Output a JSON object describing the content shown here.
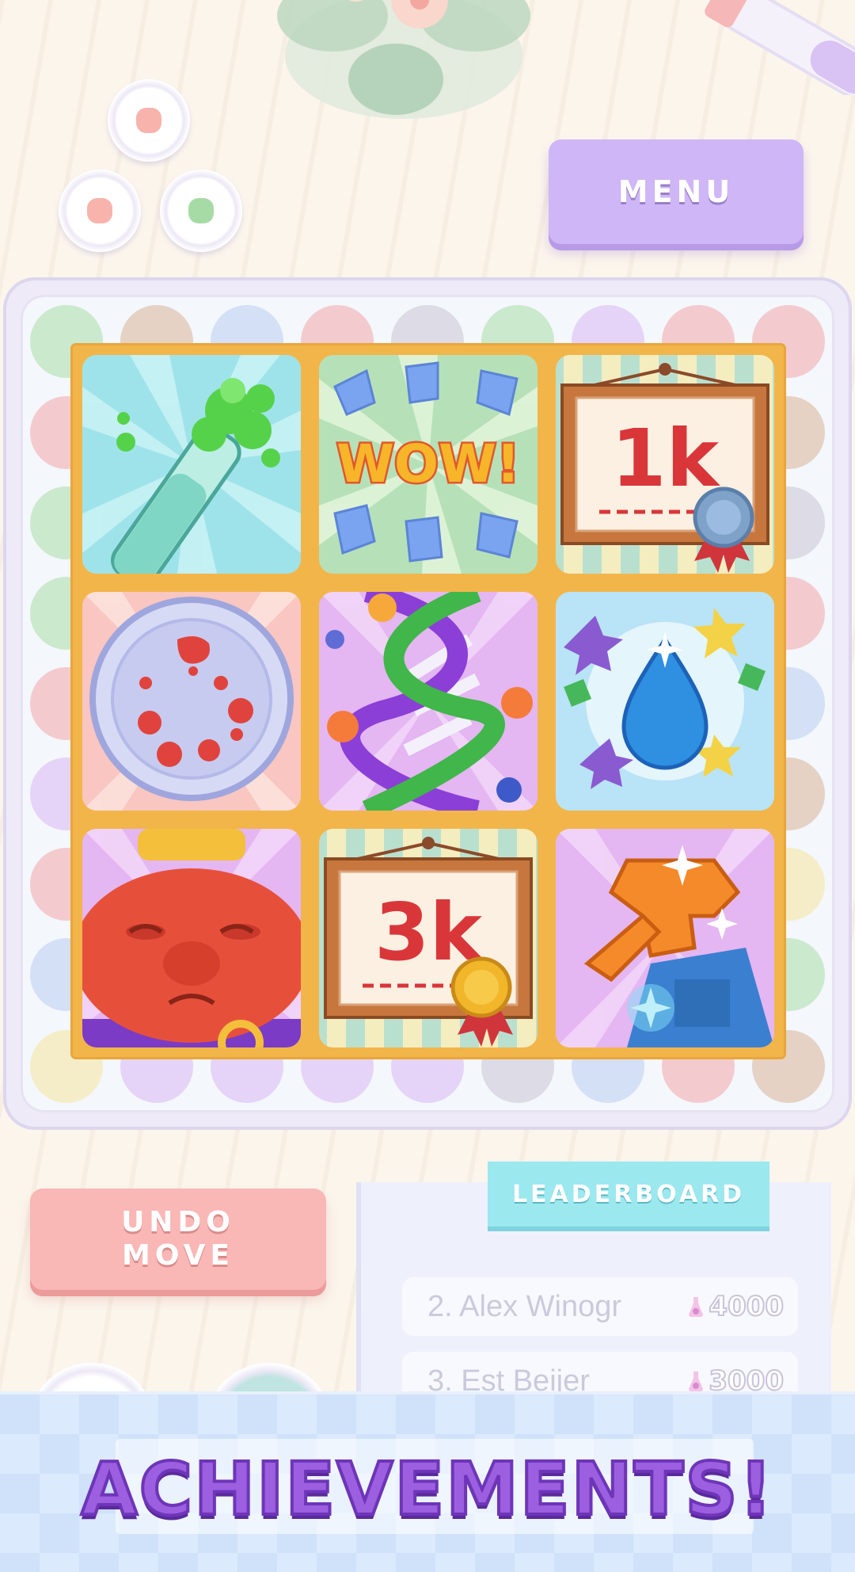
{
  "header": {
    "menu_label": "MENU"
  },
  "board": {
    "achievements": [
      {
        "name": "green-flask-bubbles",
        "icon": "flask-icon"
      },
      {
        "name": "wow-badge",
        "text": "WOW!",
        "icon": "wow-icon"
      },
      {
        "name": "1k-certificate",
        "text": "1k",
        "icon": "certificate-icon"
      },
      {
        "name": "petri-dish",
        "icon": "petri-dish-icon"
      },
      {
        "name": "dna-helix",
        "icon": "dna-icon"
      },
      {
        "name": "water-drop",
        "icon": "water-drop-icon"
      },
      {
        "name": "red-blob-creature",
        "icon": "blob-creature-icon"
      },
      {
        "name": "3k-certificate",
        "text": "3k",
        "icon": "certificate-icon"
      },
      {
        "name": "spray-bottle",
        "icon": "spray-bottle-icon"
      }
    ]
  },
  "controls": {
    "undo_line1": "UNDO",
    "undo_line2": "MOVE"
  },
  "leaderboard": {
    "title": "LEADERBOARD",
    "rows": [
      {
        "name": "2. Alex Winogr",
        "score": "4000"
      },
      {
        "name": "3. Est Beijer",
        "score": "3000"
      }
    ]
  },
  "banner": {
    "title": "ACHIEVEMENTS!"
  },
  "colors": {
    "menu": "#cfb6f6",
    "undo": "#f9b7b6",
    "leaderboard_tab": "#9be8ef",
    "grid_frame": "#f2b54a",
    "banner_text": "#9b5fe0"
  }
}
